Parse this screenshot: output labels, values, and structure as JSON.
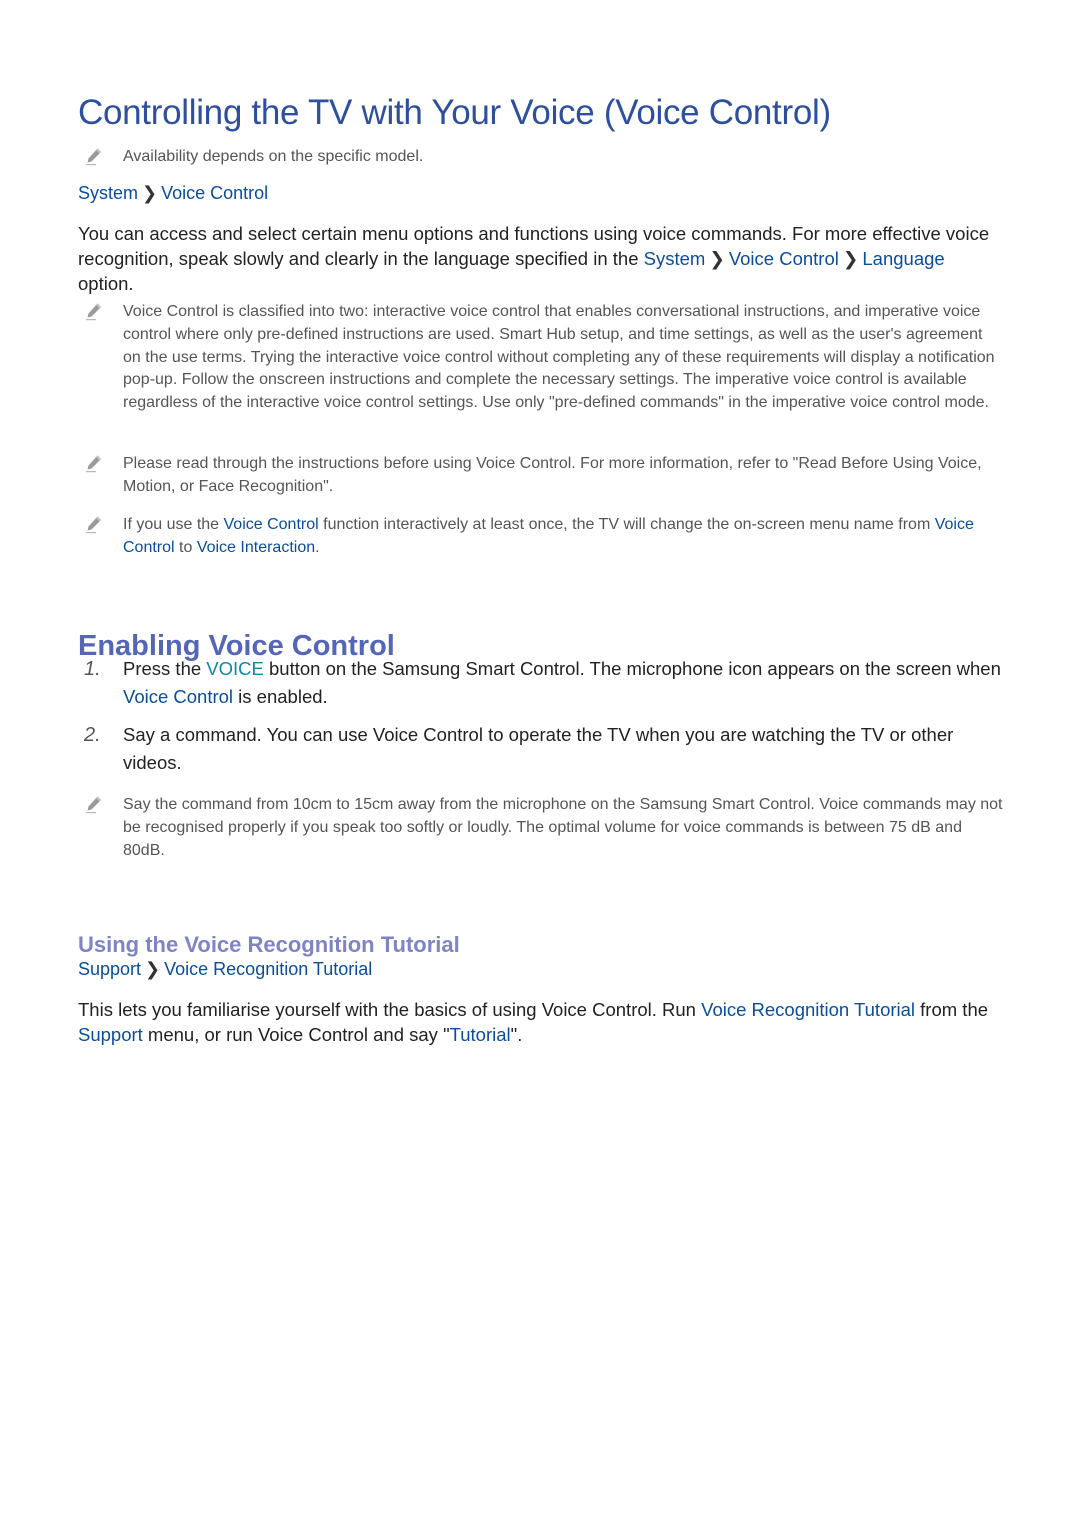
{
  "title": "Controlling the TV with Your Voice (Voice Control)",
  "note_availability": "Availability depends on the specific model.",
  "breadcrumb1": {
    "a": "System",
    "b": "Voice Control",
    "sep_icon": "chevron-right-icon"
  },
  "intro": {
    "t1": "You can access and select certain menu options and functions using voice commands. For more effective voice recognition, speak slowly and clearly in the language specified in the ",
    "l1": "System",
    "l2": "Voice Control",
    "l3": "Language",
    "t2": " option."
  },
  "note_classified": "Voice Control is classified into two: interactive voice control that enables conversational instructions, and imperative voice control where only pre-defined instructions are used. Smart Hub setup, and time settings, as well as the user's agreement on the use terms. Trying the interactive voice control without completing any of these requirements will display a notification pop-up. Follow the onscreen instructions and complete the necessary settings. The imperative voice control is available regardless of the interactive voice control settings. Use only \"pre-defined commands\" in the imperative voice control mode.",
  "note_read": "Please read through the instructions before using Voice Control. For more information, refer to \"Read Before Using Voice, Motion, or Face Recognition\".",
  "note_interactive": {
    "t1": "If you use the ",
    "l1": "Voice Control",
    "t2": " function interactively at least once, the TV will  change the on-screen menu name from ",
    "l2": "Voice Control",
    "t3": " to ",
    "l3": "Voice Interaction",
    "t4": "."
  },
  "section2": {
    "heading": "Enabling Voice Control",
    "steps": [
      {
        "num": "1.",
        "t1": "Press the ",
        "k1": "VOICE",
        "t2": " button on the Samsung Smart Control. The microphone icon appears on the screen when ",
        "l1": "Voice Control",
        "t3": " is enabled."
      },
      {
        "num": "2.",
        "t1": "Say a command. You can use Voice Control to operate the TV when you are watching the TV or other videos."
      }
    ],
    "note_distance": "Say the command from 10cm to 15cm away from the microphone on the Samsung Smart Control. Voice commands may not be recognised properly if you speak too softly or loudly. The optimal volume for voice commands is between 75 dB and 80dB."
  },
  "section3": {
    "heading": "Using the Voice Recognition Tutorial",
    "breadcrumb": {
      "a": "Support",
      "b": "Voice Recognition Tutorial"
    },
    "para": {
      "t1": "This lets you familiarise yourself with the basics of using Voice Control. Run ",
      "l1": "Voice Recognition Tutorial",
      "t2": " from the ",
      "l2": "Support",
      "t3": " menu, or run Voice Control and say \"",
      "l3": "Tutorial",
      "t4": "\"."
    }
  },
  "colors": {
    "title": "#2d4f9e",
    "h2": "#5566b8",
    "h3": "#7f84c4",
    "link": "#0a4d9a",
    "keyword": "#0a8aa3",
    "note_text": "#555555"
  }
}
